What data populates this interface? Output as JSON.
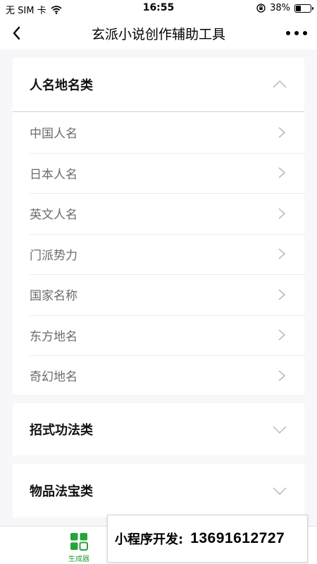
{
  "status_bar": {
    "carrier": "无 SIM 卡",
    "time": "16:55",
    "battery_percent": "38%",
    "battery_level": 0.38
  },
  "nav": {
    "title": "玄派小说创作辅助工具"
  },
  "sections": [
    {
      "title": "人名地名类",
      "expanded": true,
      "items": [
        "中国人名",
        "日本人名",
        "英文人名",
        "门派势力",
        "国家名称",
        "东方地名",
        "奇幻地名"
      ]
    },
    {
      "title": "招式功法类",
      "expanded": false
    },
    {
      "title": "物品法宝类",
      "expanded": false
    }
  ],
  "tab_bar": {
    "generator_label": "生成器",
    "active_color": "#27a33a"
  },
  "banner": {
    "label": "小程序开发:",
    "phone": "13691612727"
  }
}
